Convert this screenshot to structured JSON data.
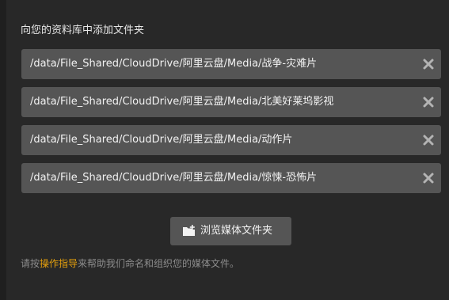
{
  "dialog": {
    "heading": "向您的资料库中添加文件夹",
    "folders": [
      {
        "path": "/data/File_Shared/CloudDrive/阿里云盘/Media/战争-灾难片"
      },
      {
        "path": "/data/File_Shared/CloudDrive/阿里云盘/Media/北美好莱坞影视"
      },
      {
        "path": "/data/File_Shared/CloudDrive/阿里云盘/Media/动作片"
      },
      {
        "path": "/data/File_Shared/CloudDrive/阿里云盘/Media/惊悚-恐怖片"
      }
    ],
    "browse_label": "浏览媒体文件夹",
    "help": {
      "prefix": "请按",
      "link": "操作指导",
      "suffix": "来帮助我们命名和组织您的媒体文件。"
    }
  },
  "colors": {
    "background": "#1f1f1f",
    "panel": "#282828",
    "row": "#555555",
    "text": "#f2f2f2",
    "muted": "#8c8c8c",
    "accent": "#e5a00d",
    "remove_icon": "#b3b3b3"
  },
  "icons": {
    "remove": "close-icon",
    "browse": "folder-add-icon"
  }
}
